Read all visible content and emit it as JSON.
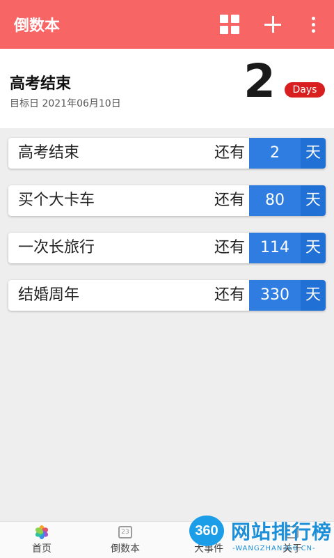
{
  "appbar": {
    "title": "倒数本"
  },
  "hero": {
    "name": "高考结束",
    "date": "目标日 2021年06月10日",
    "count": "2",
    "badge": "Days"
  },
  "events": [
    {
      "name": "高考结束",
      "prefix": "还有",
      "count": "2",
      "unit": "天"
    },
    {
      "name": "买个大卡车",
      "prefix": "还有",
      "count": "80",
      "unit": "天"
    },
    {
      "name": "一次长旅行",
      "prefix": "还有",
      "count": "114",
      "unit": "天"
    },
    {
      "name": "结婚周年",
      "prefix": "还有",
      "count": "330",
      "unit": "天"
    }
  ],
  "nav": [
    {
      "label": "首页",
      "icon": "flower-icon"
    },
    {
      "label": "倒数本",
      "icon": "calendar-icon"
    },
    {
      "label": "大事件",
      "icon": "event-icon"
    },
    {
      "label": "关于",
      "icon": "about-icon"
    }
  ],
  "calendar_icon_text": "23",
  "watermark": {
    "logo": "360",
    "text": "网站排行榜",
    "url": "-WANGZHAN360.CN-"
  },
  "colors": {
    "appbar": "#f76565",
    "count_bg": "#2f7de1",
    "badge": "#d81e1e"
  }
}
